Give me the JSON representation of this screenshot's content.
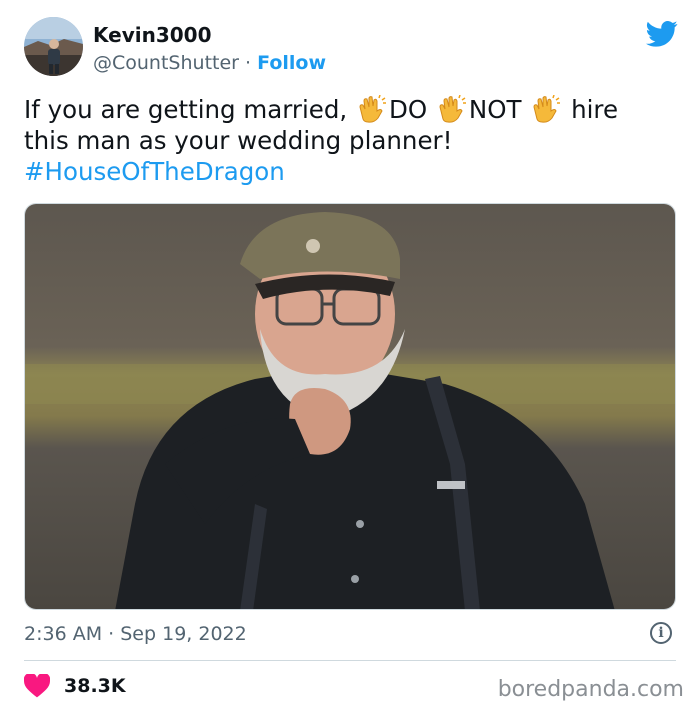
{
  "author": {
    "display_name": "Kevin3000",
    "handle": "@CountShutter",
    "separator": "·",
    "follow_label": "Follow"
  },
  "tweet": {
    "line1_a": "If you are getting married, ",
    "word_do": "DO ",
    "word_not": "NOT ",
    "line1_b": " hire",
    "line2": "this man as your wedding planner!",
    "hashtag": "#HouseOfTheDragon"
  },
  "meta": {
    "time": "2:36 AM",
    "separator": "·",
    "date": "Sep 19, 2022"
  },
  "engagement": {
    "likes": "38.3K"
  },
  "watermark": "boredpanda.com",
  "icons": {
    "bird": "twitter-bird-icon",
    "info": "info-icon",
    "heart": "heart-icon",
    "clap": "clapping-hands-icon"
  },
  "colors": {
    "link": "#1d9bf0",
    "muted": "#536471",
    "heart": "#f91880",
    "text": "#0f1419"
  }
}
